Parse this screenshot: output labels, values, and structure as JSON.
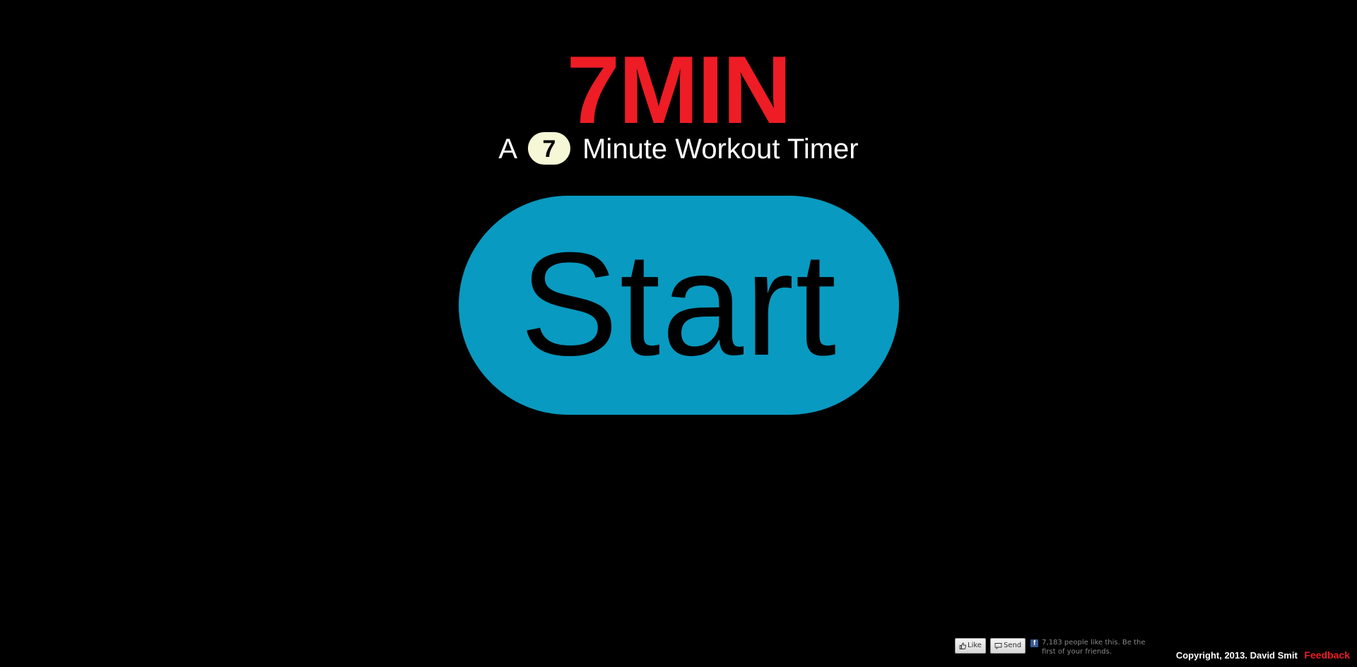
{
  "header": {
    "logo_text": "7MIN",
    "subtitle_before": "A",
    "subtitle_badge": "7",
    "subtitle_after": "Minute Workout Timer"
  },
  "main": {
    "start_label": "Start"
  },
  "social": {
    "like_label": "Like",
    "send_label": "Send",
    "facebook_glyph": "f",
    "like_count_text": "7,183 people like this. Be the first of your friends."
  },
  "footer": {
    "copyright": "Copyright, 2013. David Smit",
    "feedback_label": "Feedback"
  },
  "colors": {
    "background": "#000000",
    "brand_red": "#ee1c25",
    "start_blue": "#089ac0",
    "badge_bg": "#f5f7d6",
    "facebook_blue": "#3b5998"
  },
  "icons": {
    "like": "thumbs-up-icon",
    "send": "speech-bubble-icon",
    "facebook": "facebook-icon"
  }
}
